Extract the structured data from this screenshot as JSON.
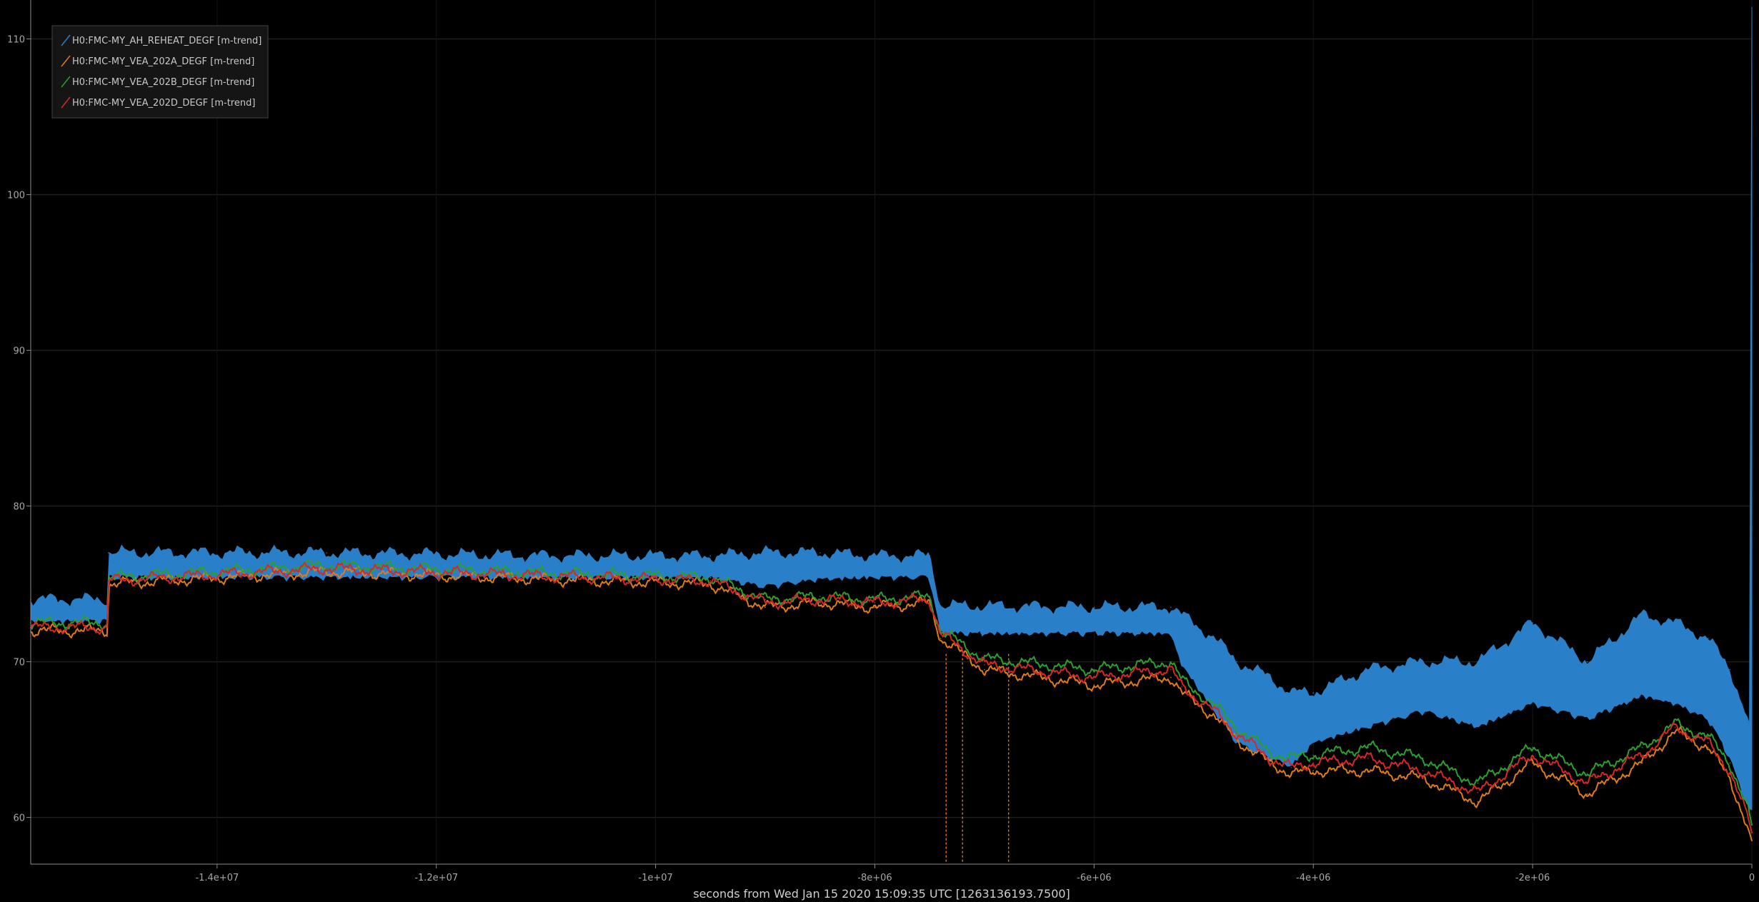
{
  "chart_data": {
    "type": "line",
    "title": "",
    "xlabel": "seconds from Wed Jan 15 2020 15:09:35 UTC [1263136193.7500]",
    "ylabel": "",
    "xlim": [
      -15700000,
      0
    ],
    "ylim": [
      57,
      112.5
    ],
    "grid": true,
    "legend_position": "top-left",
    "background": "#000000",
    "x_ticks": [
      {
        "value": -14000000,
        "label": "-1.4e+07"
      },
      {
        "value": -12000000,
        "label": "-1.2e+07"
      },
      {
        "value": -10000000,
        "label": "-1e+07"
      },
      {
        "value": -8000000,
        "label": "-8e+06"
      },
      {
        "value": -6000000,
        "label": "-6e+06"
      },
      {
        "value": -4000000,
        "label": "-4e+06"
      },
      {
        "value": -2000000,
        "label": "-2e+06"
      },
      {
        "value": 0,
        "label": "0"
      }
    ],
    "y_ticks": [
      {
        "value": 60,
        "label": "60"
      },
      {
        "value": 70,
        "label": "70"
      },
      {
        "value": 80,
        "label": "80"
      },
      {
        "value": 90,
        "label": "90"
      },
      {
        "value": 100,
        "label": "100"
      },
      {
        "value": 110,
        "label": "110"
      }
    ],
    "series": [
      {
        "name": "H0:FMC-MY_AH_REHEAT_DEGF [m-trend]",
        "color": "#2a7fc9",
        "band": true,
        "x": [
          -15700000,
          -15000000,
          -14990000,
          -13000000,
          -11000000,
          -9500000,
          -9000000,
          -8500000,
          -8000000,
          -7500000,
          -7400000,
          -6000000,
          -5300000,
          -5200000,
          -4900000,
          -4700000,
          -4400000,
          -4200000,
          -4000000,
          -3500000,
          -3000000,
          -2500000,
          -2000000,
          -1500000,
          -1000000,
          -700000,
          -400000,
          -200000,
          -20000,
          0
        ],
        "upper": [
          74.0,
          74.0,
          77.0,
          77.0,
          76.8,
          76.8,
          77.0,
          77.0,
          76.8,
          76.8,
          73.6,
          73.5,
          73.5,
          73.0,
          71.5,
          70.0,
          69.0,
          68.0,
          68.0,
          69.5,
          70.0,
          70.0,
          72.5,
          70.0,
          73.0,
          72.5,
          71.5,
          69.5,
          66.0,
          112.0
        ],
        "lower": [
          72.8,
          72.8,
          75.6,
          75.6,
          75.6,
          75.6,
          75.0,
          75.5,
          75.6,
          75.6,
          72.0,
          72.0,
          72.0,
          70.0,
          67.0,
          65.0,
          64.0,
          63.5,
          65.0,
          66.0,
          67.0,
          66.0,
          67.5,
          66.5,
          68.0,
          67.5,
          66.5,
          64.0,
          60.5,
          60.5
        ]
      },
      {
        "name": "H0:FMC-MY_VEA_202A_DEGF [m-trend]",
        "color": "#e07b1a",
        "x": [
          -15700000,
          -15000000,
          -14990000,
          -13000000,
          -11000000,
          -9500000,
          -9000000,
          -8500000,
          -8000000,
          -7500000,
          -7400000,
          -7000000,
          -6000000,
          -5300000,
          -5200000,
          -4900000,
          -4700000,
          -4400000,
          -4200000,
          -4000000,
          -3500000,
          -3000000,
          -2500000,
          -2000000,
          -1500000,
          -1000000,
          -700000,
          -400000,
          -200000,
          -20000,
          0
        ],
        "y": [
          72.0,
          72.0,
          75.0,
          75.8,
          75.3,
          75.0,
          73.5,
          73.8,
          73.5,
          73.8,
          71.5,
          69.5,
          68.5,
          69.0,
          68.0,
          66.5,
          65.0,
          63.5,
          62.8,
          63.0,
          63.0,
          62.5,
          61.0,
          63.5,
          61.5,
          63.5,
          65.5,
          64.5,
          62.5,
          59.0,
          58.5
        ]
      },
      {
        "name": "H0:FMC-MY_VEA_202B_DEGF [m-trend]",
        "color": "#2ca02c",
        "x": [
          -15700000,
          -15000000,
          -14990000,
          -13000000,
          -11000000,
          -9500000,
          -9000000,
          -8500000,
          -8000000,
          -7500000,
          -7400000,
          -7000000,
          -6000000,
          -5300000,
          -5200000,
          -4900000,
          -4700000,
          -4400000,
          -4200000,
          -4000000,
          -3500000,
          -3000000,
          -2500000,
          -2000000,
          -1500000,
          -1000000,
          -700000,
          -400000,
          -200000,
          -20000,
          0
        ],
        "y": [
          72.5,
          72.5,
          75.4,
          76.2,
          75.7,
          75.4,
          74.0,
          74.2,
          74.0,
          74.2,
          72.0,
          70.2,
          69.5,
          70.0,
          68.8,
          67.2,
          65.8,
          64.2,
          63.8,
          64.0,
          64.5,
          63.8,
          62.2,
          64.5,
          62.8,
          64.5,
          66.0,
          65.2,
          63.5,
          60.2,
          59.5
        ]
      },
      {
        "name": "H0:FMC-MY_VEA_202D_DEGF [m-trend]",
        "color": "#d62728",
        "x": [
          -15700000,
          -15000000,
          -14990000,
          -13000000,
          -11000000,
          -9500000,
          -9000000,
          -8500000,
          -8000000,
          -7500000,
          -7400000,
          -7000000,
          -6000000,
          -5300000,
          -5200000,
          -4900000,
          -4700000,
          -4400000,
          -4200000,
          -4000000,
          -3500000,
          -3000000,
          -2500000,
          -2000000,
          -1500000,
          -1000000,
          -700000,
          -400000,
          -200000,
          -20000,
          0
        ],
        "y": [
          72.2,
          72.2,
          75.2,
          76.0,
          75.5,
          75.2,
          73.8,
          74.0,
          73.8,
          74.0,
          71.8,
          69.8,
          69.0,
          69.5,
          68.4,
          66.8,
          65.4,
          63.8,
          63.2,
          63.5,
          63.8,
          63.0,
          61.6,
          64.0,
          62.2,
          64.0,
          65.8,
          64.8,
          63.0,
          59.6,
          59.0
        ]
      }
    ],
    "dropouts": [
      {
        "x": -7350000,
        "color": "#e07b1a"
      },
      {
        "x": -7200000,
        "color": "#e07b1a"
      },
      {
        "x": -6780000,
        "color": "#e07b1a"
      }
    ]
  }
}
